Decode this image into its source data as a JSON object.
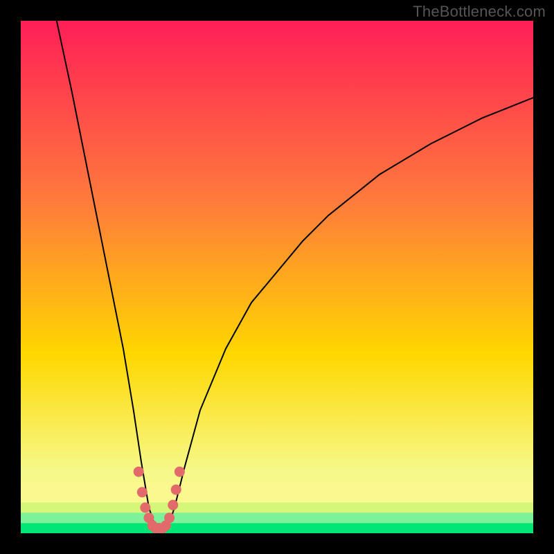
{
  "watermark": "TheBottleneck.com",
  "chart_data": {
    "type": "line",
    "title": "",
    "xlabel": "",
    "ylabel": "",
    "xlim": [
      0,
      100
    ],
    "ylim": [
      0,
      100
    ],
    "grid": false,
    "legend": false,
    "background_gradient": {
      "top_color": "#ff1f56",
      "mid_color": "#ffd700",
      "bottom_color": "#00e676"
    },
    "series": [
      {
        "name": "bottleneck-curve",
        "color": "#000000",
        "x": [
          7,
          8.5,
          10,
          12,
          14,
          16,
          18,
          20,
          22,
          23.5,
          25,
          26,
          27,
          28,
          29,
          30,
          32,
          35,
          40,
          45,
          50,
          55,
          60,
          65,
          70,
          75,
          80,
          85,
          90,
          95,
          100
        ],
        "values": [
          100,
          93,
          86,
          76,
          66,
          56,
          46,
          36,
          24,
          14,
          5,
          2,
          1,
          1,
          2,
          5,
          13,
          24,
          36,
          45,
          51,
          57,
          62,
          66,
          70,
          73,
          76,
          78.5,
          81,
          83,
          85
        ]
      }
    ],
    "marker_series": {
      "name": "optimal-zone-dots",
      "color": "#e26a6a",
      "x": [
        23.0,
        23.7,
        24.3,
        25.0,
        25.7,
        26.3,
        27.0,
        27.7,
        28.3,
        29.0,
        29.7,
        30.3,
        31.0
      ],
      "values": [
        12.0,
        8.0,
        5.0,
        3.0,
        1.5,
        1.0,
        1.0,
        1.0,
        1.5,
        3.0,
        5.5,
        8.5,
        12.0
      ]
    },
    "bottom_bands": [
      {
        "y_from": 0.0,
        "y_to": 2.0,
        "color": "#00e676"
      },
      {
        "y_from": 2.0,
        "y_to": 4.0,
        "color": "#7ef29a"
      },
      {
        "y_from": 4.0,
        "y_to": 6.0,
        "color": "#d4f77a"
      },
      {
        "y_from": 6.0,
        "y_to": 10.0,
        "color": "#faf88e"
      }
    ]
  }
}
